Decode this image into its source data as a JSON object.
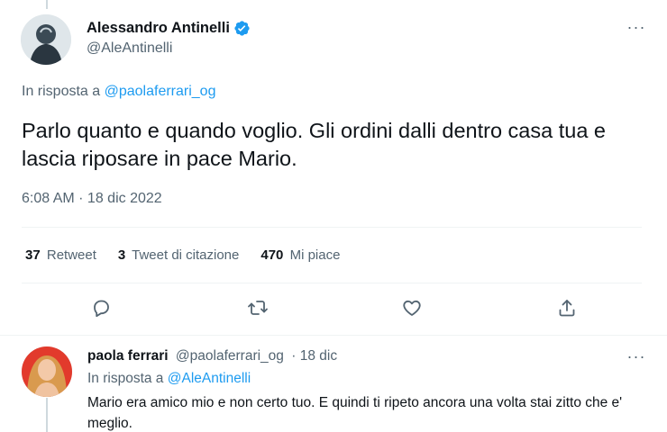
{
  "main_tweet": {
    "author_name": "Alessandro Antinelli",
    "author_handle": "@AleAntinelli",
    "verified": true,
    "replying_prefix": "In risposta a",
    "replying_to": "@paolaferrari_og",
    "text": "Parlo quanto e quando voglio. Gli ordini dalli dentro casa tua e lascia riposare in pace Mario.",
    "timestamp": "6:08 AM · 18 dic 2022",
    "stats": {
      "retweets_count": "37",
      "retweets_label": "Retweet",
      "quotes_count": "3",
      "quotes_label": "Tweet di citazione",
      "likes_count": "470",
      "likes_label": "Mi piace"
    },
    "more_label": "···",
    "actions": [
      "reply-icon",
      "retweet-icon",
      "like-icon",
      "share-icon"
    ]
  },
  "reply_tweet": {
    "author_name": "paola ferrari",
    "author_handle": "@paolaferrari_og",
    "date": "· 18 dic",
    "replying_prefix": "In risposta a",
    "replying_to": "@AleAntinelli",
    "text": "Mario era amico mio e non certo tuo. E quindi ti ripeto ancora una volta stai zitto che e' meglio.",
    "more_label": "···"
  },
  "colors": {
    "link": "#1d9bf0",
    "secondary_text": "#536471",
    "primary_text": "#0f1419",
    "divider": "#eff3f4"
  }
}
